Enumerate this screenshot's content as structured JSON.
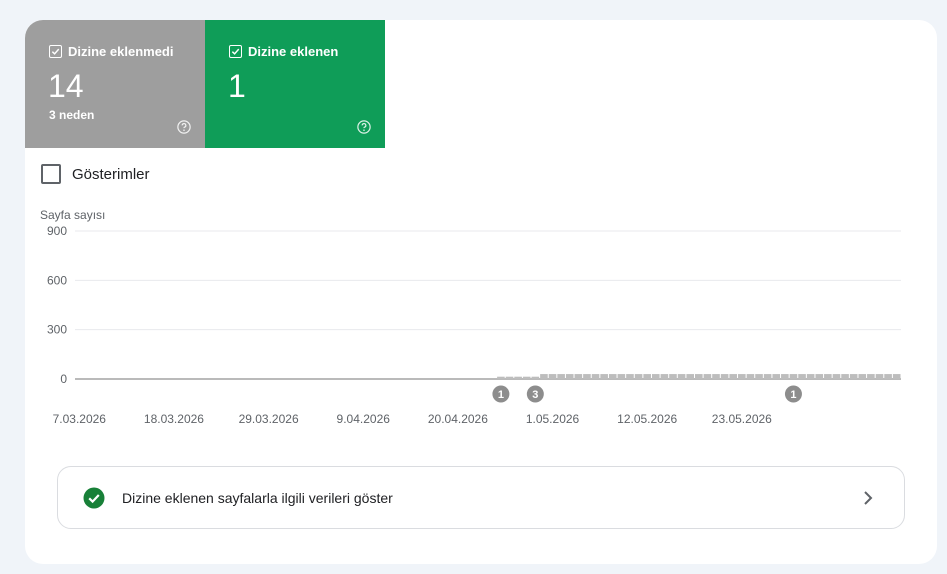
{
  "tiles": {
    "not_indexed": {
      "label": "Dizine eklenmedi",
      "count": "14",
      "sub": "3 neden",
      "checked": true,
      "color": "#9e9e9e"
    },
    "indexed": {
      "label": "Dizine eklenen",
      "count": "1",
      "checked": true,
      "color": "#0f9d58"
    }
  },
  "impressions": {
    "label": "Gösterimler",
    "checked": false
  },
  "chart_data": {
    "type": "bar",
    "ylabel": "Sayfa sayısı",
    "ylim": [
      0,
      900
    ],
    "yticks": [
      0,
      300,
      600,
      900
    ],
    "x_ticks": [
      "7.03.2026",
      "18.03.2026",
      "29.03.2026",
      "9.04.2026",
      "20.04.2026",
      "1.05.2026",
      "12.05.2026",
      "23.05.2026"
    ],
    "start_date": "7.03.2026",
    "values": [
      0,
      0,
      0,
      0,
      0,
      0,
      0,
      0,
      0,
      0,
      0,
      0,
      0,
      0,
      0,
      0,
      0,
      0,
      0,
      0,
      0,
      0,
      0,
      0,
      0,
      0,
      0,
      0,
      0,
      0,
      0,
      0,
      0,
      0,
      0,
      0,
      0,
      0,
      0,
      0,
      0,
      0,
      0,
      0,
      0,
      0,
      0,
      0,
      0,
      14,
      14,
      14,
      14,
      14,
      30,
      30,
      30,
      30,
      30,
      30,
      30,
      30,
      30,
      30,
      30,
      30,
      30,
      30,
      30,
      30,
      30,
      30,
      30,
      30,
      30,
      30,
      30,
      30,
      30,
      30,
      30,
      30,
      30,
      30,
      30,
      30,
      30,
      30,
      30,
      30,
      30,
      30,
      30,
      30,
      30,
      30
    ],
    "bar_color": "#bdbdbd",
    "annotations": [
      {
        "label": "1",
        "index": 49
      },
      {
        "label": "3",
        "index": 53
      },
      {
        "label": "1",
        "index": 83
      }
    ]
  },
  "link": {
    "label": "Dizine eklenen sayfalarla ilgili verileri göster",
    "icon": "check-circle-icon",
    "color": "#188038"
  }
}
